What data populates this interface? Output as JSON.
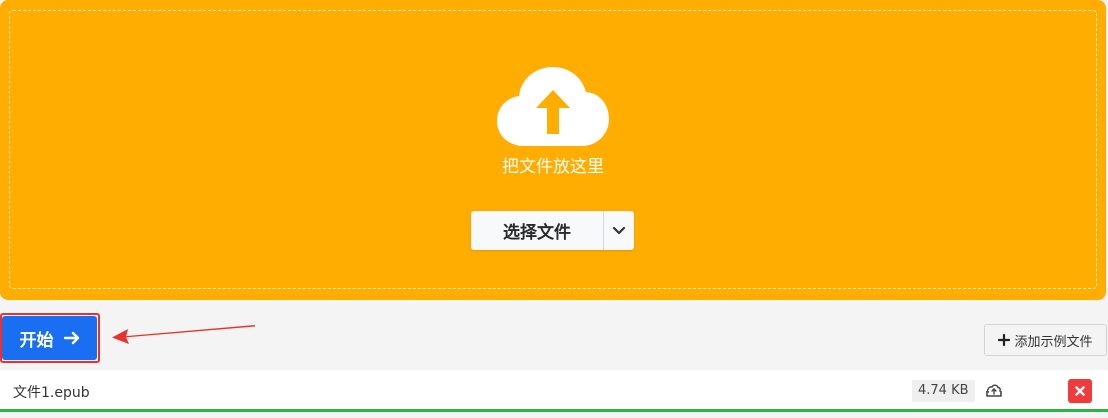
{
  "dropzone": {
    "icon": "cloud-upload-icon",
    "text": "把文件放这里",
    "select_label": "选择文件",
    "caret_icon": "chevron-down-icon",
    "background": "#ffad00"
  },
  "actions": {
    "start_label": "开始",
    "start_icon": "arrow-right-icon",
    "start_color": "#1a6ef2",
    "add_sample_icon": "plus-icon",
    "add_sample_label": "添加示例文件"
  },
  "files": [
    {
      "name": "文件1.epub",
      "size": "4.74 KB",
      "upload_icon": "cloud-upload-outline-icon",
      "remove_icon": "close-icon",
      "progress_percent": 100
    }
  ]
}
